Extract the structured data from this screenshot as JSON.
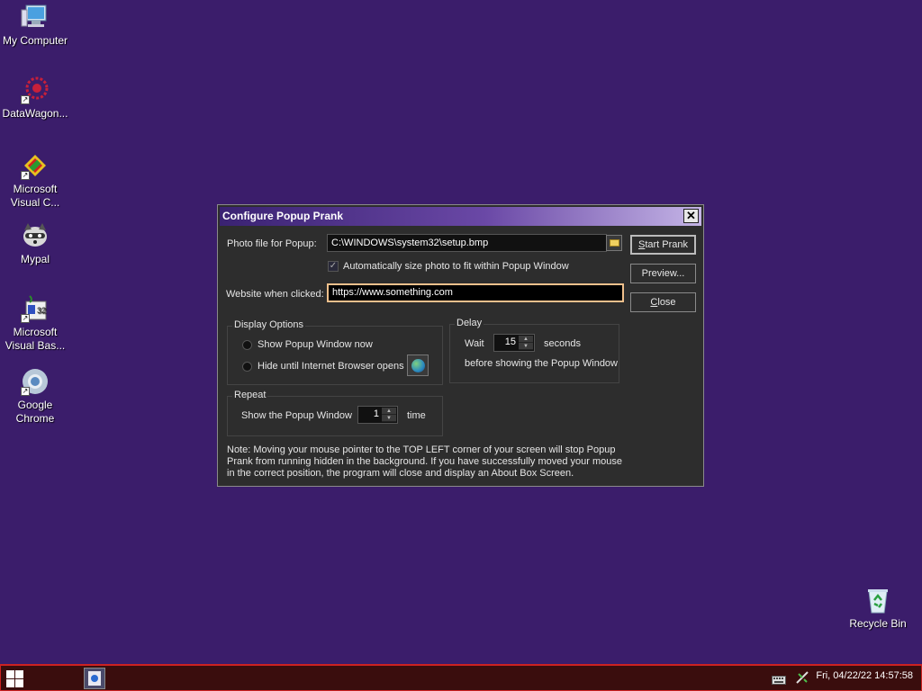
{
  "desktop": {
    "icons": [
      {
        "label": "My Computer"
      },
      {
        "label": "DataWagon..."
      },
      {
        "label": "Microsoft Visual C..."
      },
      {
        "label": "Mypal"
      },
      {
        "label": "Microsoft Visual Bas..."
      },
      {
        "label": "Google Chrome"
      },
      {
        "label": "Recycle Bin"
      }
    ]
  },
  "dialog": {
    "title": "Configure Popup Prank",
    "close_glyph": "✕",
    "photo_label": "Photo file for Popup:",
    "photo_value": "C:\\WINDOWS\\system32\\setup.bmp",
    "autosize_label": "Automatically size photo to fit within Popup Window",
    "autosize_checked": true,
    "website_label": "Website when clicked:",
    "website_value": "https://www.something.com",
    "buttons": {
      "start_prefix": "S",
      "start_rest": "tart Prank",
      "preview": "Preview...",
      "close_prefix": "C",
      "close_rest": "lose"
    },
    "display_options": {
      "title": "Display Options",
      "opt1": "Show Popup Window now",
      "opt2": "Hide until Internet Browser opens"
    },
    "delay": {
      "title": "Delay",
      "wait_label": "Wait",
      "wait_value": "15",
      "seconds_label": "seconds",
      "before_label": "before showing the Popup Window"
    },
    "repeat": {
      "title": "Repeat",
      "show_label": "Show the Popup Window",
      "count_value": "1",
      "time_label": "time"
    },
    "note": "Note: Moving your mouse pointer to the TOP LEFT corner of your screen will stop Popup Prank from running hidden in the background. If you have successfully moved your mouse in the correct position, the program will close and display an About Box Screen."
  },
  "taskbar": {
    "clock": "Fri, 04/22/22 14:57:58"
  },
  "colors": {
    "desktop": "#3b1d6b",
    "dialog_bg": "#2d2d2d",
    "taskbar_border": "#cc2222"
  }
}
